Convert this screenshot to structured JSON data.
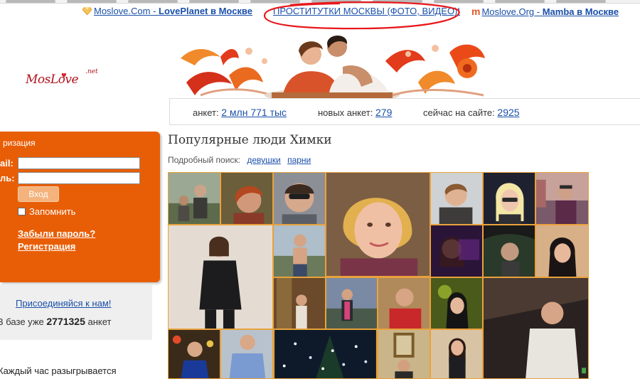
{
  "top_links": {
    "lovelink_site": "Moslove.Com",
    "lovelink_sep": " - ",
    "lovelink_name": "LovePlanet в Москве",
    "promo": "ПРОСТИТУТКИ МОСКВЫ (ФОТО, ВИДЕО)!",
    "mamba_site": "Moslove.Org",
    "mamba_sep": " - ",
    "mamba_name": "Mamba в Москве"
  },
  "logo": {
    "text": "MosLove",
    "suffix": ".net"
  },
  "stats": {
    "profiles_label": "анкет:",
    "profiles_value": "2 млн 771 тыс",
    "new_label": "новых анкет:",
    "new_value": "279",
    "online_label": "сейчас на сайте:",
    "online_value": "2925"
  },
  "login": {
    "title": "ризация",
    "email_label": "ail:",
    "password_label": "ль:",
    "email_value": "",
    "password_value": "",
    "button": "Вход",
    "remember": "Запомнить",
    "forgot": "Забыли пароль?",
    "register": "Регистрация"
  },
  "join": {
    "link": "Присоединяйся к нам!",
    "count_prefix": "В базе уже",
    "count_value": "2771325",
    "count_suffix": "анкет"
  },
  "prize_text": "Каждый час разыгрывается",
  "main": {
    "heading": "Популярные люди Химки",
    "search_label": "Подробный поиск:",
    "girls": "девушки",
    "guys": "парни"
  },
  "colors": {
    "orange": "#e85e06",
    "link": "#1a4fa8",
    "grid_border": "#e9a23c"
  }
}
